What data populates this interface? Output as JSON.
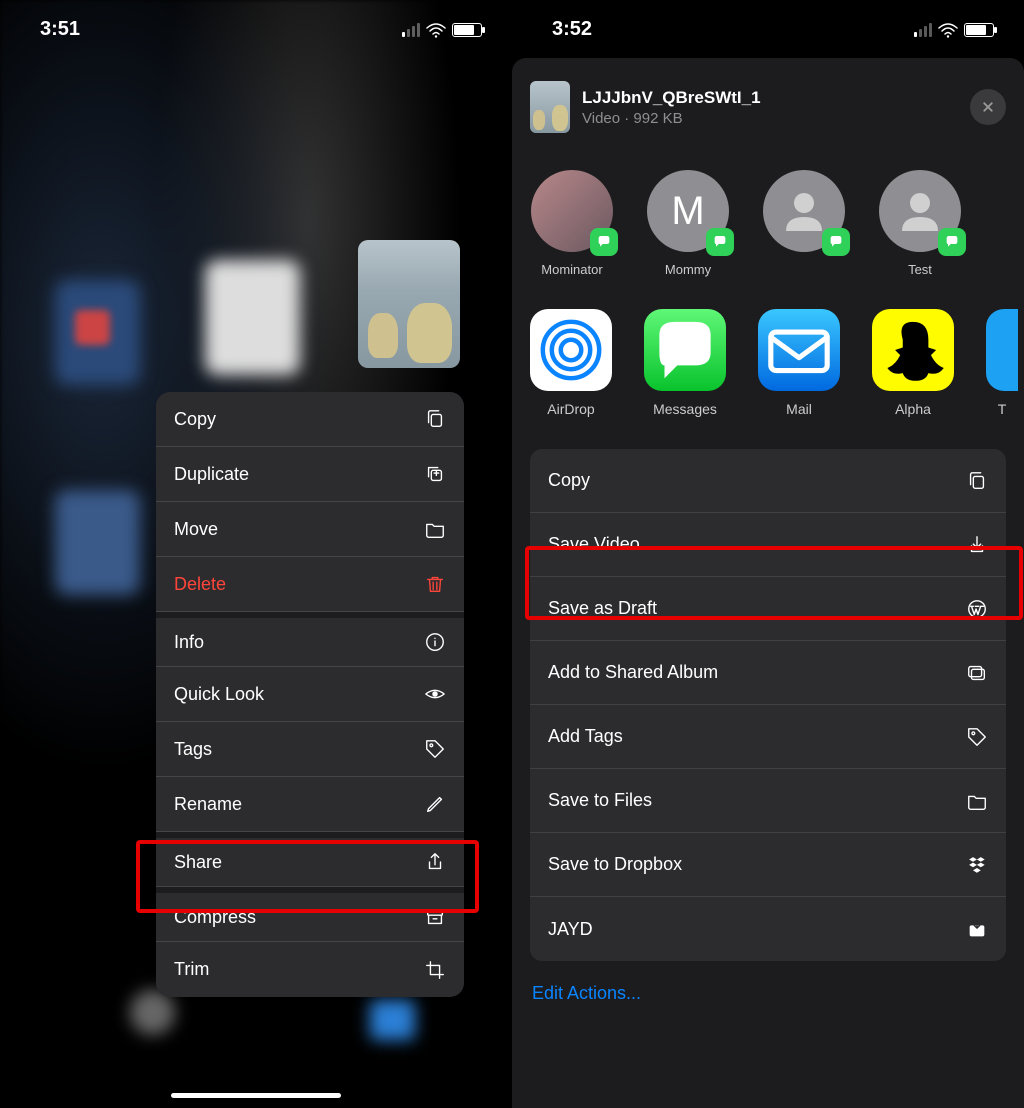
{
  "left": {
    "status_time": "3:51",
    "menu": {
      "copy": "Copy",
      "duplicate": "Duplicate",
      "move": "Move",
      "delete": "Delete",
      "info": "Info",
      "quick_look": "Quick Look",
      "tags": "Tags",
      "rename": "Rename",
      "share": "Share",
      "compress": "Compress",
      "trim": "Trim"
    }
  },
  "right": {
    "status_time": "3:52",
    "file": {
      "name": "LJJJbnV_QBreSWtI_1",
      "subtitle": "Video · 992 KB"
    },
    "contacts": [
      {
        "name": "Mominator",
        "avatar_type": "photo"
      },
      {
        "name": "Mommy",
        "avatar_type": "letter",
        "letter": "M"
      },
      {
        "name": "",
        "avatar_type": "generic"
      },
      {
        "name": "Test",
        "avatar_type": "generic"
      }
    ],
    "apps": [
      {
        "name": "AirDrop"
      },
      {
        "name": "Messages"
      },
      {
        "name": "Mail"
      },
      {
        "name": "Alpha"
      },
      {
        "name": "T"
      }
    ],
    "actions": {
      "copy": "Copy",
      "save_video": "Save Video",
      "save_as_draft": "Save as Draft",
      "add_to_shared_album": "Add to Shared Album",
      "add_tags": "Add Tags",
      "save_to_files": "Save to Files",
      "save_to_dropbox": "Save to Dropbox",
      "jayd": "JAYD"
    },
    "edit_actions": "Edit Actions..."
  }
}
